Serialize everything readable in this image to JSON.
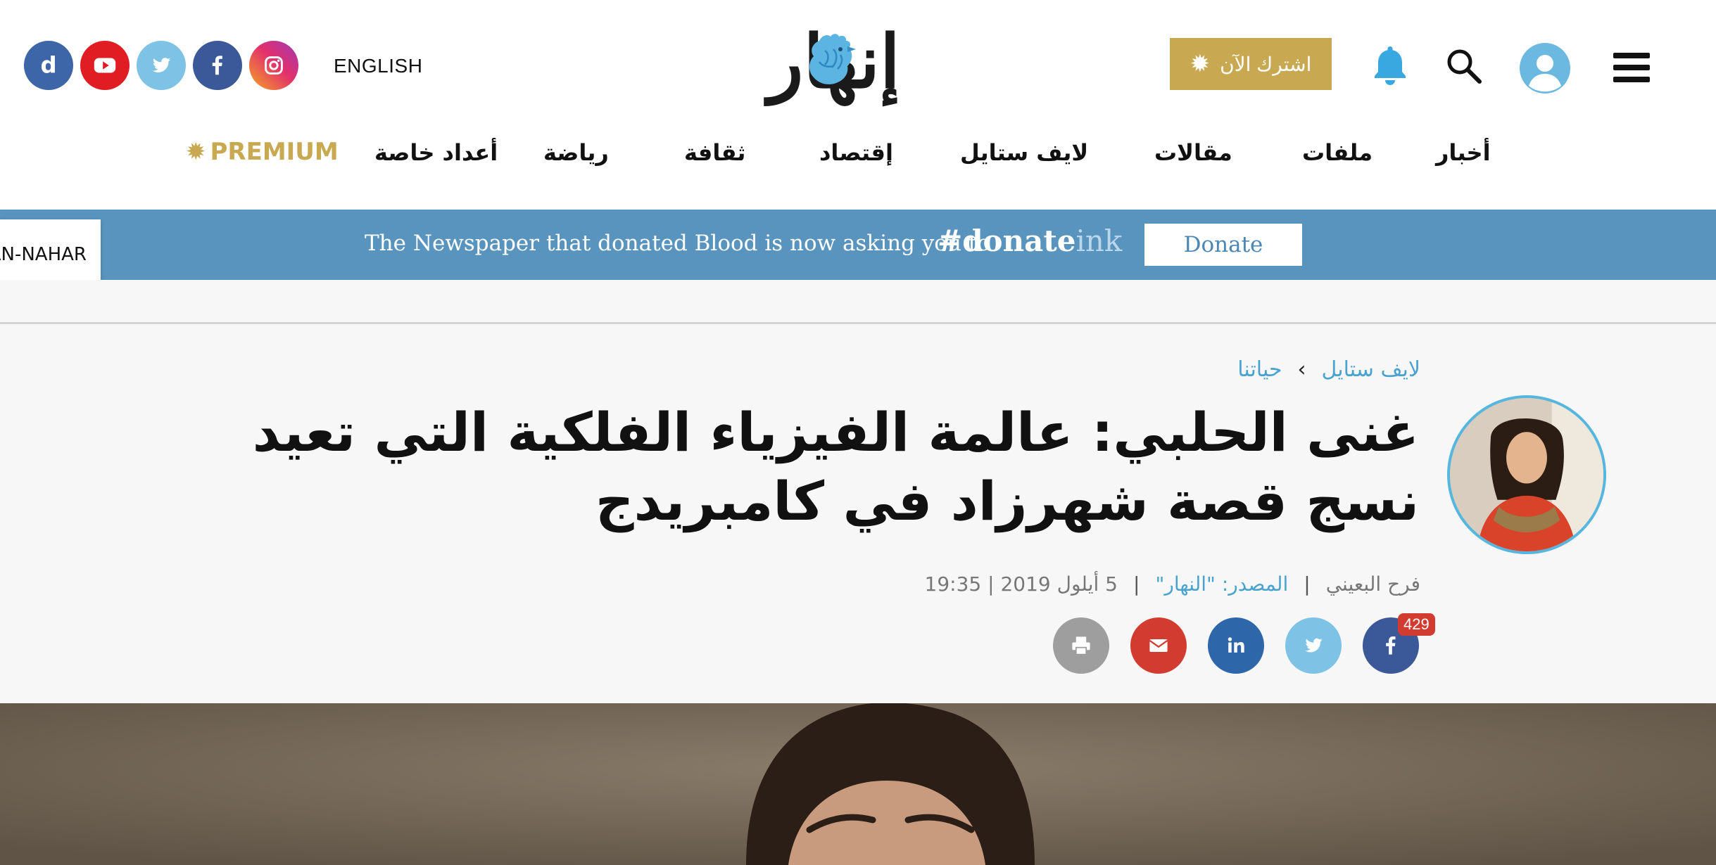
{
  "header": {
    "english_label": "ENGLISH",
    "logo_text": "إنهار",
    "subscribe_label": "اشترك الآن",
    "social": [
      "d-icon",
      "youtube-icon",
      "twitter-icon",
      "facebook-icon",
      "instagram-icon"
    ]
  },
  "nav": {
    "items": [
      "أخبار",
      "ملفات",
      "مقالات",
      "لايف ستايل",
      "إقتصاد",
      "ثقافة",
      "رياضة",
      "أعداد خاصة"
    ],
    "premium_label": "PREMIUM"
  },
  "banner": {
    "tab_label": "AN-NAHAR",
    "text": "The Newspaper that donated Blood is now asking you to",
    "tag_bold": "#donate",
    "tag_light": "ink",
    "donate_label": "Donate"
  },
  "article": {
    "breadcrumb": [
      "لايف ستايل",
      "حياتنا"
    ],
    "breadcrumb_sep": "›",
    "headline": "غنى الحلبي: عالمة الفيزياء الفلكية التي تعيد نسج قصة شهرزاد في كامبريدج",
    "author": "فرح البعيني",
    "source": "المصدر: \"النهار\"",
    "date": "5 أيلول 2019 | 19:35",
    "share_count": "429"
  },
  "colors": {
    "gold": "#c8a951",
    "banner_blue": "#5894bd",
    "link_blue": "#4aa3cf",
    "facebook": "#3b5998",
    "twitter": "#7ec3e6",
    "linkedin": "#2e67a9",
    "mail": "#d23b2f",
    "print": "#9e9e9e"
  }
}
